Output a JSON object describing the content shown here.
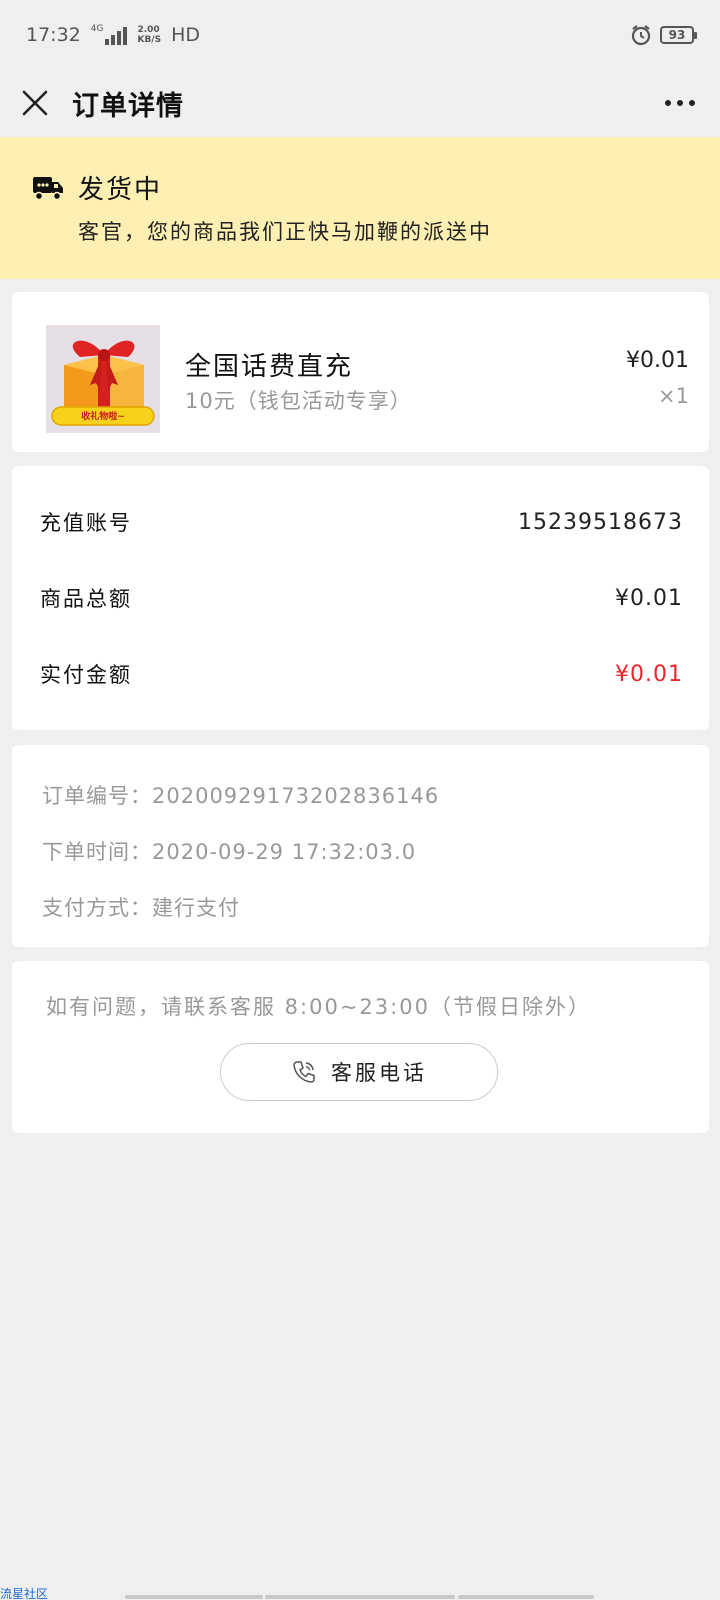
{
  "status_bar": {
    "time": "17:32",
    "network_type": "4G",
    "speed_value": "2.00",
    "speed_unit": "KB/S",
    "hd_label": "HD",
    "battery": "93"
  },
  "nav": {
    "title": "订单详情"
  },
  "banner": {
    "title": "发货中",
    "subtitle": "客官，您的商品我们正快马加鞭的派送中"
  },
  "product": {
    "title": "全国话费直充",
    "subtitle": "10元（钱包活动专享）",
    "price": "¥0.01",
    "quantity": "×1",
    "image_caption": "收礼物啦~"
  },
  "info": {
    "rows": [
      {
        "label": "充值账号",
        "value": "15239518673"
      },
      {
        "label": "商品总额",
        "value": "¥0.01"
      },
      {
        "label": "实付金额",
        "value": "¥0.01"
      }
    ],
    "paid_color": "#e8262b"
  },
  "meta": {
    "rows": [
      "订单编号：20200929173202836146",
      "下单时间：2020-09-29 17:32:03.0",
      "支付方式：建行支付"
    ]
  },
  "help": {
    "text": "如有问题，请联系客服 8:00~23:00（节假日除外）",
    "button_label": "客服电话",
    "button_icon": "phone-icon"
  },
  "watermark": "流星社区",
  "colors": {
    "banner_bg": "#fdf0b2",
    "page_bg": "#efefef"
  }
}
